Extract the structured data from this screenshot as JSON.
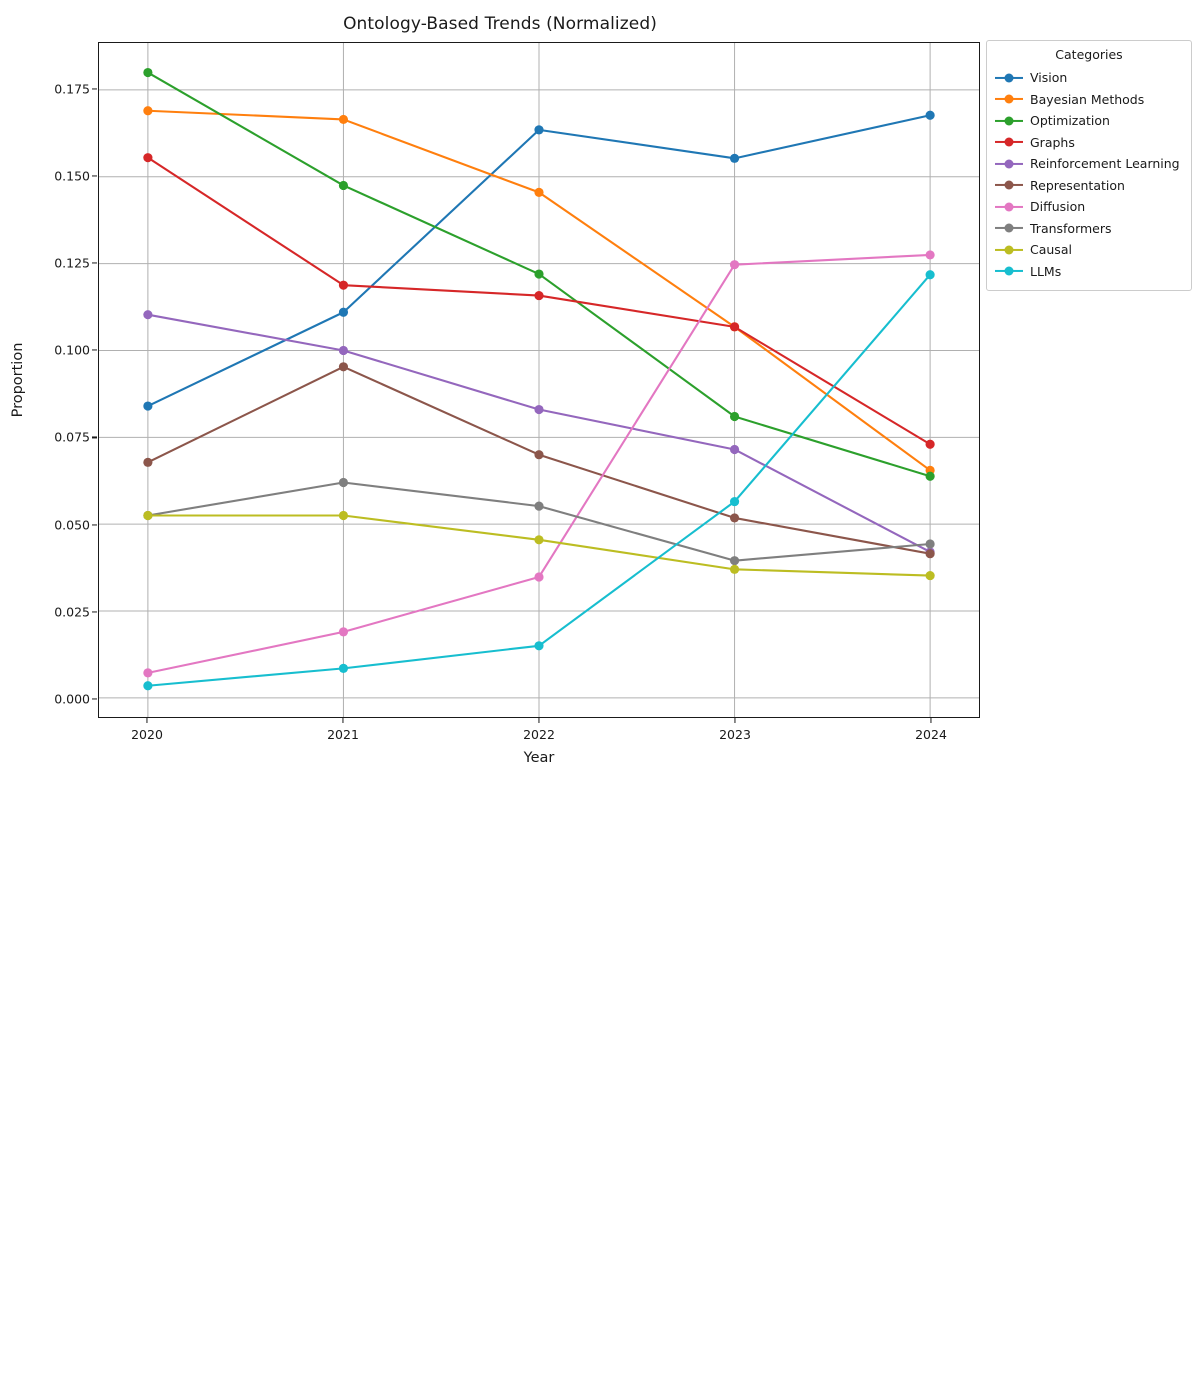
{
  "chart_data": {
    "type": "line",
    "title": "Ontology-Based Trends (Normalized)",
    "xlabel": "Year",
    "ylabel": "Proportion",
    "legend_title": "Categories",
    "legend_position": "upper right, outside",
    "grid": true,
    "x": [
      "2020",
      "2021",
      "2022",
      "2023",
      "2024"
    ],
    "categories": [
      "2020",
      "2021",
      "2022",
      "2023",
      "2024"
    ],
    "xlim": [
      2019.75,
      2024.25
    ],
    "ylim": [
      -0.0055,
      0.1885
    ],
    "yticks": [
      "0.000",
      "0.025",
      "0.050",
      "0.075",
      "0.100",
      "0.125",
      "0.150",
      "0.175"
    ],
    "ytick_values": [
      0.0,
      0.025,
      0.05,
      0.075,
      0.1,
      0.125,
      0.15,
      0.175
    ],
    "marker": "circle",
    "series": [
      {
        "name": "Vision",
        "color": "#1f77b4",
        "values": [
          0.084,
          0.111,
          0.1635,
          0.1553,
          0.1677
        ]
      },
      {
        "name": "Bayesian Methods",
        "color": "#ff7f0e",
        "values": [
          0.169,
          0.1665,
          0.1455,
          0.1068,
          0.0655
        ]
      },
      {
        "name": "Optimization",
        "color": "#2ca02c",
        "values": [
          0.18,
          0.1475,
          0.122,
          0.081,
          0.0638
        ]
      },
      {
        "name": "Graphs",
        "color": "#d62728",
        "values": [
          0.1555,
          0.1188,
          0.1158,
          0.1068,
          0.073
        ]
      },
      {
        "name": "Reinforcement Learning",
        "color": "#9467bd",
        "values": [
          0.1103,
          0.1,
          0.083,
          0.0715,
          0.042
        ]
      },
      {
        "name": "Representation",
        "color": "#8c564b",
        "values": [
          0.0678,
          0.0953,
          0.07,
          0.0518,
          0.0415
        ]
      },
      {
        "name": "Diffusion",
        "color": "#e377c2",
        "values": [
          0.0072,
          0.019,
          0.0348,
          0.1247,
          0.1275
        ]
      },
      {
        "name": "Transformers",
        "color": "#7f7f7f",
        "values": [
          0.0525,
          0.062,
          0.0552,
          0.0395,
          0.0443
        ]
      },
      {
        "name": "Causal",
        "color": "#bcbd22",
        "values": [
          0.0525,
          0.0525,
          0.0455,
          0.037,
          0.0352
        ]
      },
      {
        "name": "LLMs",
        "color": "#17becf",
        "values": [
          0.0035,
          0.0085,
          0.015,
          0.0565,
          0.1218
        ]
      }
    ]
  }
}
